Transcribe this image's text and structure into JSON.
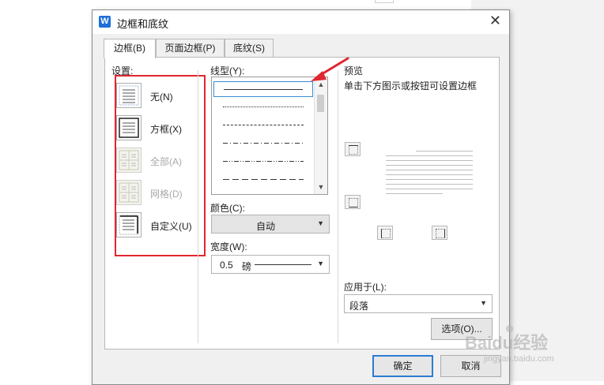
{
  "dialog": {
    "title": "边框和底纹",
    "app_icon_letter": "W"
  },
  "tabs": [
    {
      "label": "边框(B)",
      "active": true
    },
    {
      "label": "页面边框(P)",
      "active": false
    },
    {
      "label": "底纹(S)",
      "active": false
    }
  ],
  "settings": {
    "heading": "设置:",
    "items": [
      {
        "label": "无(N)",
        "enabled": true
      },
      {
        "label": "方框(X)",
        "enabled": true
      },
      {
        "label": "全部(A)",
        "enabled": false
      },
      {
        "label": "网格(D)",
        "enabled": false
      },
      {
        "label": "自定义(U)",
        "enabled": true
      }
    ]
  },
  "line_style": {
    "heading": "线型(Y):",
    "styles": [
      "solid",
      "dotted",
      "dashed",
      "dash-dot",
      "dash-dot-dot",
      "long-dash"
    ]
  },
  "color": {
    "heading": "颜色(C):",
    "value": "自动"
  },
  "width": {
    "heading": "宽度(W):",
    "value": "0.5",
    "unit": "磅"
  },
  "preview": {
    "heading": "预览",
    "hint": "单击下方图示或按钮可设置边框"
  },
  "apply_to": {
    "heading": "应用于(L):",
    "value": "段落"
  },
  "buttons": {
    "options": "选项(O)...",
    "ok": "确定",
    "cancel": "取消"
  },
  "watermark": {
    "text": "Baidu经验",
    "sub": "jingyan.baidu.com"
  },
  "colors": {
    "accent": "#2b7cd3",
    "highlight": "#e0262f"
  }
}
